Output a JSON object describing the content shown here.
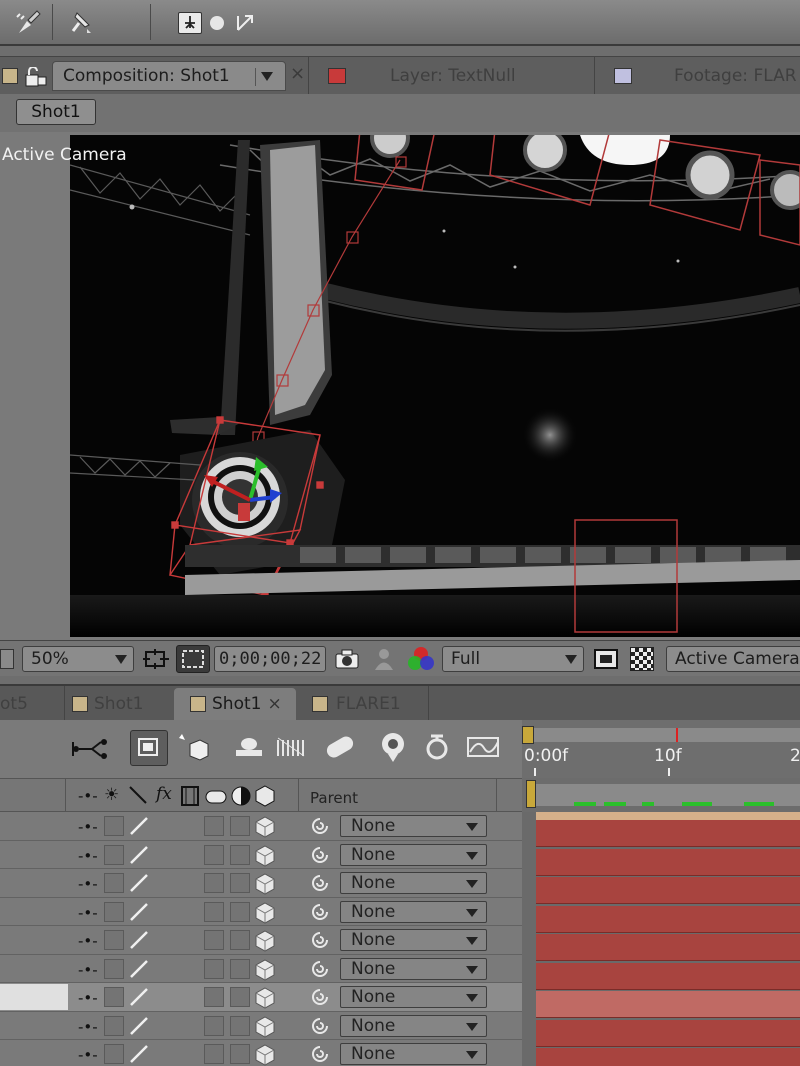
{
  "toolbar": {
    "icons": [
      "brush-icon",
      "pin-icon",
      "axis-local-icon",
      "axis-world-icon",
      "axis-view-icon"
    ]
  },
  "comp_tabs": {
    "composition": "Composition: Shot1",
    "layer": "Layer: TextNull",
    "footage": "Footage: FLAR",
    "close_glyph": "×",
    "colors": {
      "composition": "#c8b58a",
      "layer": "#c83a3a",
      "footage": "#c0c0e0"
    }
  },
  "comp_sub": {
    "active_comp": "Shot1"
  },
  "viewer": {
    "camera_label": "Active Camera"
  },
  "viewer_bar": {
    "zoom": "50%",
    "timecode": "0;00;00;22",
    "resolution": "Full",
    "view": "Active Camera"
  },
  "timeline_tabs": [
    {
      "label": "ot5",
      "swatch": "#c8b58a"
    },
    {
      "label": "Shot1",
      "swatch": "#c8b58a"
    },
    {
      "label": "Shot1",
      "swatch": "#c8b58a",
      "active": true,
      "close": "×"
    },
    {
      "label": "FLARE1",
      "swatch": "#c8b58a"
    }
  ],
  "timeline_tools": {
    "icons": [
      "composition-mini-flowchart-icon",
      "draft-3d-icon",
      "hide-shy-icon",
      "frame-blending-icon",
      "motion-blur-icon",
      "brainstorm-icon",
      "auto-keyframe-icon",
      "graph-editor-icon",
      "shape-icon"
    ]
  },
  "ruler": {
    "ticks": [
      "0:00f",
      "10f",
      "2"
    ]
  },
  "columns": {
    "parent": "Parent"
  },
  "layers": [
    {
      "parent": "None"
    },
    {
      "parent": "None"
    },
    {
      "parent": "None"
    },
    {
      "parent": "None"
    },
    {
      "parent": "None"
    },
    {
      "parent": "None"
    },
    {
      "parent": "None",
      "selected": true
    },
    {
      "parent": "None"
    },
    {
      "parent": "None"
    }
  ]
}
